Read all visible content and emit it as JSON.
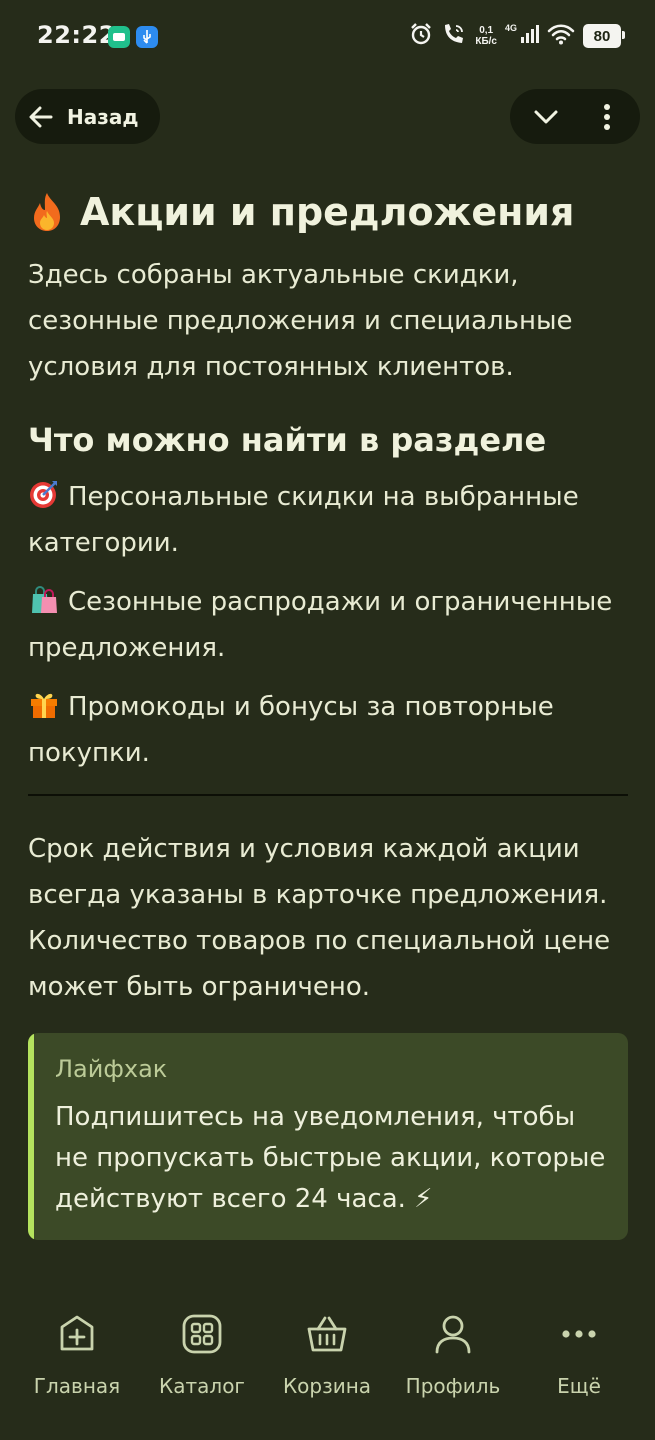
{
  "status_bar": {
    "time": "22:22",
    "net_speed_value": "0,1",
    "net_speed_unit": "КБ/с",
    "net_type": "4G",
    "battery": "80"
  },
  "nav": {
    "back_label": "Назад"
  },
  "page": {
    "title": "Акции и предложения",
    "intro": "Здесь собраны актуальные скидки, сезонные предложения и специальные условия для постоянных клиентов.",
    "section_title": "Что можно найти в разделе",
    "features": [
      {
        "icon": "target-emoji",
        "text": "Персональные скидки на выбранные категории."
      },
      {
        "icon": "shopping-bags-emoji",
        "text": "Сезонные распродажи и ограниченные предложения."
      },
      {
        "icon": "gift-emoji",
        "text": "Промокоды и бонусы за повторные покупки."
      }
    ],
    "terms": "Срок действия и условия каждой акции всегда указаны в карточке предложения. Количество товаров по специальной цене может быть ограничено.",
    "tip": {
      "label": "Лайфхак",
      "text": "Подпишитесь на уведомления, чтобы не пропускать быстрые акции, которые действуют всего 24 часа. ⚡"
    }
  },
  "bottom_nav": {
    "items": [
      {
        "label": "Главная",
        "icon": "plus-square-icon"
      },
      {
        "label": "Каталог",
        "icon": "grid-icon"
      },
      {
        "label": "Корзина",
        "icon": "basket-icon"
      },
      {
        "label": "Профиль",
        "icon": "user-icon"
      },
      {
        "label": "Ещё",
        "icon": "more-horizontal-icon"
      }
    ]
  },
  "colors": {
    "background": "#262c1a",
    "accent": "#b5e35e",
    "tip_background": "#3c4a27",
    "pill_background": "#161b0e"
  }
}
